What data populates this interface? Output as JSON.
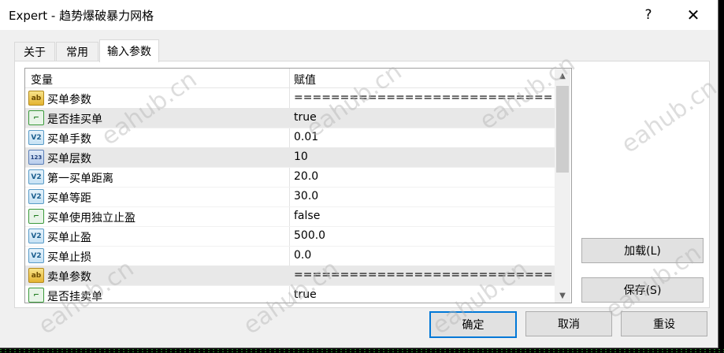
{
  "window": {
    "title": "Expert - 趋势爆破暴力网格",
    "help_label": "?",
    "close_label": "✕"
  },
  "tabs": [
    {
      "label": "关于"
    },
    {
      "label": "常用"
    },
    {
      "label": "输入参数"
    }
  ],
  "grid": {
    "col_variable": "变量",
    "col_value": "赋值",
    "rows": [
      {
        "icon": "ab",
        "name": "买单参数",
        "value": "==============================..."
      },
      {
        "icon": "bool",
        "name": "是否挂买单",
        "value": "true"
      },
      {
        "icon": "v2",
        "name": "买单手数",
        "value": "0.01"
      },
      {
        "icon": "123",
        "name": "买单层数",
        "value": "10"
      },
      {
        "icon": "v2",
        "name": "第一买单距离",
        "value": "20.0"
      },
      {
        "icon": "v2",
        "name": "买单等距",
        "value": "30.0"
      },
      {
        "icon": "bool",
        "name": "买单使用独立止盈",
        "value": "false"
      },
      {
        "icon": "v2",
        "name": "买单止盈",
        "value": "500.0"
      },
      {
        "icon": "v2",
        "name": "买单止损",
        "value": "0.0"
      },
      {
        "icon": "ab",
        "name": "卖单参数",
        "value": "==============================..."
      },
      {
        "icon": "bool",
        "name": "是否挂卖单",
        "value": "true"
      }
    ]
  },
  "side_buttons": {
    "load": "加载(L)",
    "save": "保存(S)"
  },
  "footer_buttons": {
    "ok": "确定",
    "cancel": "取消",
    "reset": "重设"
  },
  "watermark": "eahub.cn"
}
